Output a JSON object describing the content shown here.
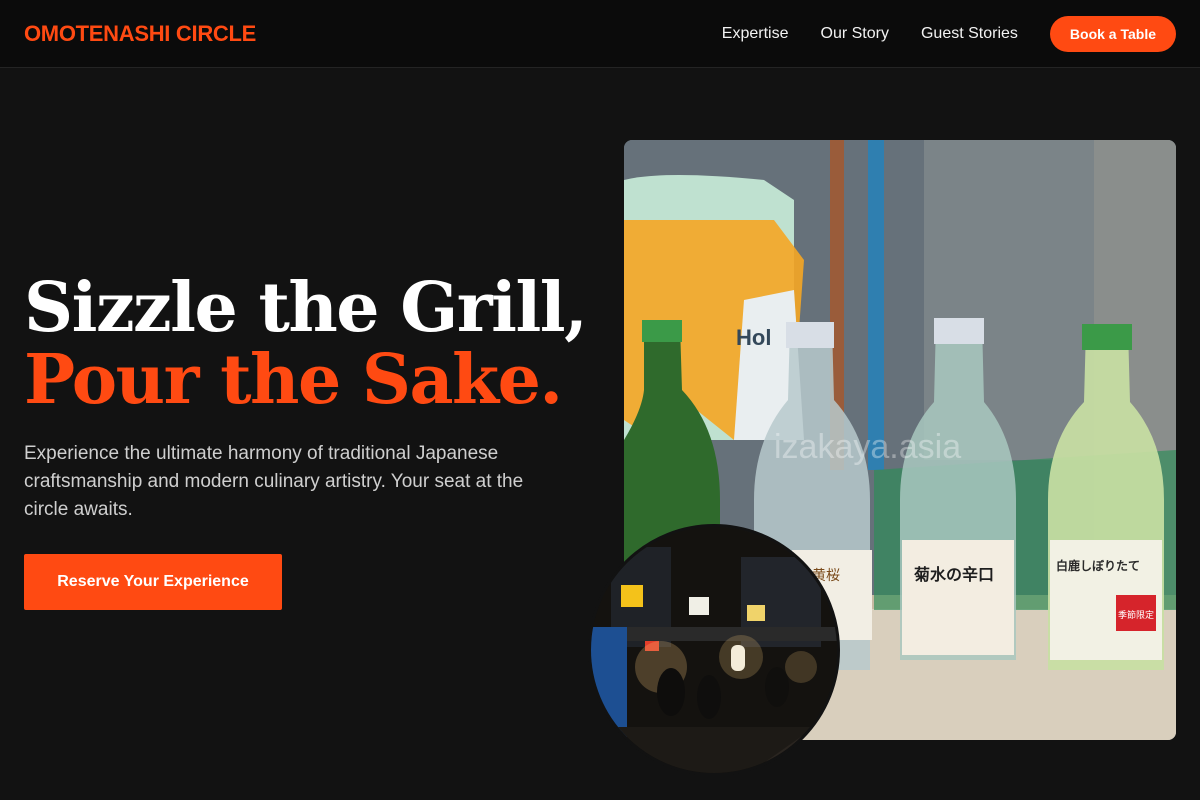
{
  "brand": {
    "name": "OMOTENASHI CIRCLE",
    "accent": "#ff4a12"
  },
  "nav": {
    "links": [
      "Expertise",
      "Our Story",
      "Guest Stories"
    ],
    "cta": "Book a Table"
  },
  "hero": {
    "headline_line1": "Sizzle the Grill,",
    "headline_line2": "Pour the Sake.",
    "subtext": "Experience the ultimate harmony of traditional Japanese craftsmanship and modern culinary artistry. Your seat at the circle awaits.",
    "button": "Reserve Your Experience"
  },
  "images": {
    "main_alt": "sake bottles photo",
    "main_watermark": "izakaya.asia",
    "bottle_labels": [
      "黄桜",
      "菊水の辛口",
      "白鹿しぼりたて",
      "季節限定"
    ],
    "circle_alt": "night street food stalls photo"
  }
}
